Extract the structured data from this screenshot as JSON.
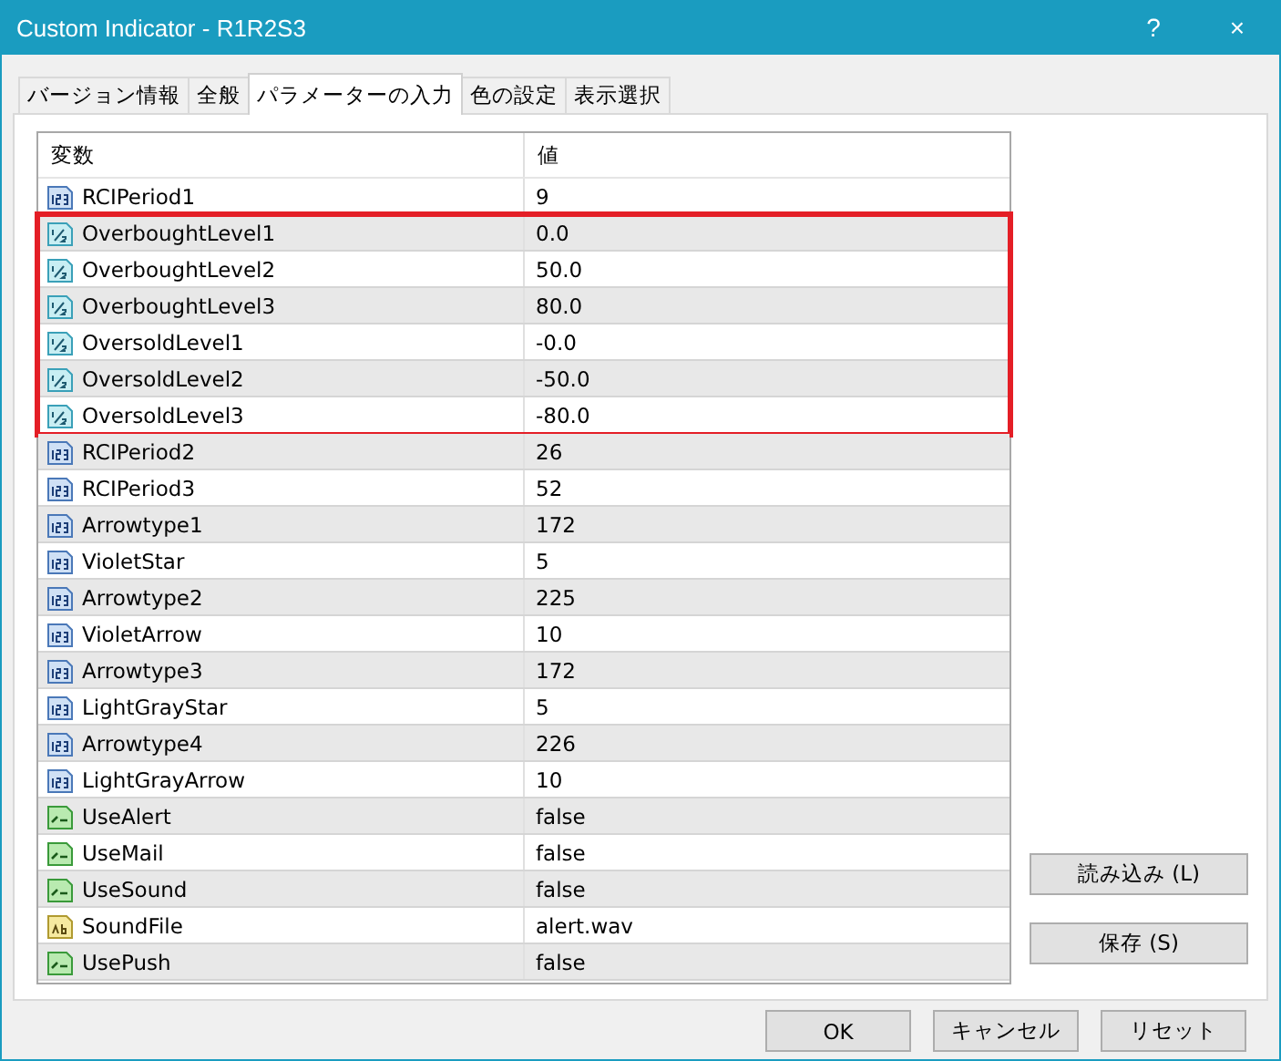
{
  "window": {
    "title": "Custom Indicator - R1R2S3",
    "help": "?",
    "close": "×"
  },
  "tabs": [
    {
      "label": "バージョン情報",
      "selected": false
    },
    {
      "label": "全般",
      "selected": false
    },
    {
      "label": "パラメーターの入力",
      "selected": true
    },
    {
      "label": "色の設定",
      "selected": false
    },
    {
      "label": "表示選択",
      "selected": false
    }
  ],
  "table": {
    "columns": [
      "変数",
      "値"
    ],
    "row_groups": [
      {
        "rows": [
          {
            "kind": "int",
            "name": "RCIPeriod1",
            "value": "9"
          }
        ]
      },
      {
        "highlighted": true,
        "rows": [
          {
            "kind": "double",
            "name": "OverboughtLevel1",
            "value": "0.0"
          },
          {
            "kind": "double",
            "name": "OverboughtLevel2",
            "value": "50.0"
          },
          {
            "kind": "double",
            "name": "OverboughtLevel3",
            "value": "80.0"
          },
          {
            "kind": "double",
            "name": "OversoldLevel1",
            "value": "-0.0"
          },
          {
            "kind": "double",
            "name": "OversoldLevel2",
            "value": "-50.0"
          },
          {
            "kind": "double",
            "name": "OversoldLevel3",
            "value": "-80.0"
          }
        ]
      },
      {
        "rows": [
          {
            "kind": "int",
            "name": "RCIPeriod2",
            "value": "26"
          },
          {
            "kind": "int",
            "name": "RCIPeriod3",
            "value": "52"
          },
          {
            "kind": "int",
            "name": "Arrowtype1",
            "value": "172"
          },
          {
            "kind": "int",
            "name": "VioletStar",
            "value": "5"
          },
          {
            "kind": "int",
            "name": "Arrowtype2",
            "value": "225"
          },
          {
            "kind": "int",
            "name": "VioletArrow",
            "value": "10"
          },
          {
            "kind": "int",
            "name": "Arrowtype3",
            "value": "172"
          },
          {
            "kind": "int",
            "name": "LightGrayStar",
            "value": "5"
          },
          {
            "kind": "int",
            "name": "Arrowtype4",
            "value": "226"
          },
          {
            "kind": "int",
            "name": "LightGrayArrow",
            "value": "10"
          },
          {
            "kind": "bool",
            "name": "UseAlert",
            "value": "false"
          },
          {
            "kind": "bool",
            "name": "UseMail",
            "value": "false"
          },
          {
            "kind": "bool",
            "name": "UseSound",
            "value": "false"
          },
          {
            "kind": "string",
            "name": "SoundFile",
            "value": "alert.wav"
          },
          {
            "kind": "bool",
            "name": "UsePush",
            "value": "false"
          }
        ]
      }
    ]
  },
  "side_buttons": [
    "読み込み (L)",
    "保存 (S)"
  ],
  "buttons": [
    "OK",
    "キャンセル",
    "リセット"
  ]
}
